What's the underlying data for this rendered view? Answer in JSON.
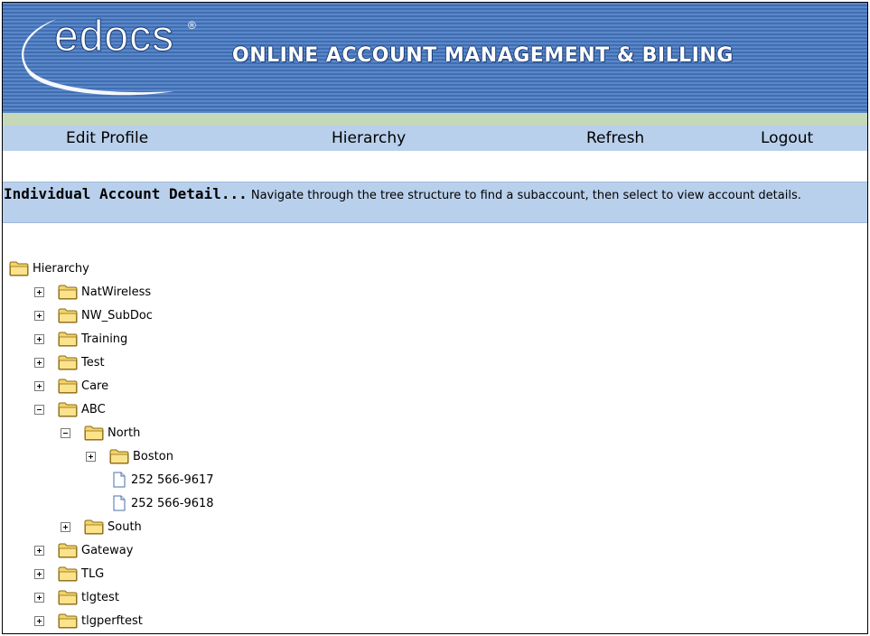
{
  "header": {
    "logo_text": "edocs",
    "logo_registered": "®",
    "banner_title": "ONLINE ACCOUNT MANAGEMENT & BILLING"
  },
  "menu": {
    "edit_profile": "Edit Profile",
    "hierarchy": "Hierarchy",
    "refresh": "Refresh",
    "logout": "Logout"
  },
  "detail": {
    "title": "Individual Account Detail...",
    "description": " Navigate through the tree structure to find a subaccount, then select to view account details."
  },
  "tree": {
    "root": "Hierarchy",
    "items": [
      {
        "label": "NatWireless",
        "state": "collapsed"
      },
      {
        "label": "NW_SubDoc",
        "state": "collapsed"
      },
      {
        "label": "Training",
        "state": "collapsed"
      },
      {
        "label": "Test",
        "state": "collapsed"
      },
      {
        "label": "Care",
        "state": "collapsed"
      },
      {
        "label": "ABC",
        "state": "expanded"
      },
      {
        "label": "North",
        "state": "expanded"
      },
      {
        "label": "Boston",
        "state": "collapsed"
      },
      {
        "label": "252 566-9617",
        "type": "document"
      },
      {
        "label": "252 566-9618",
        "type": "document"
      },
      {
        "label": "South",
        "state": "collapsed"
      },
      {
        "label": "Gateway",
        "state": "collapsed"
      },
      {
        "label": "TLG",
        "state": "collapsed"
      },
      {
        "label": "tlgtest",
        "state": "collapsed"
      },
      {
        "label": "tlgperftest",
        "state": "collapsed"
      }
    ]
  },
  "colors": {
    "banner_blue": "#4a79bd",
    "menu_blue": "#b9d0ec",
    "green_strip": "#c5d8b8",
    "folder_yellow": "#f3d36a"
  }
}
